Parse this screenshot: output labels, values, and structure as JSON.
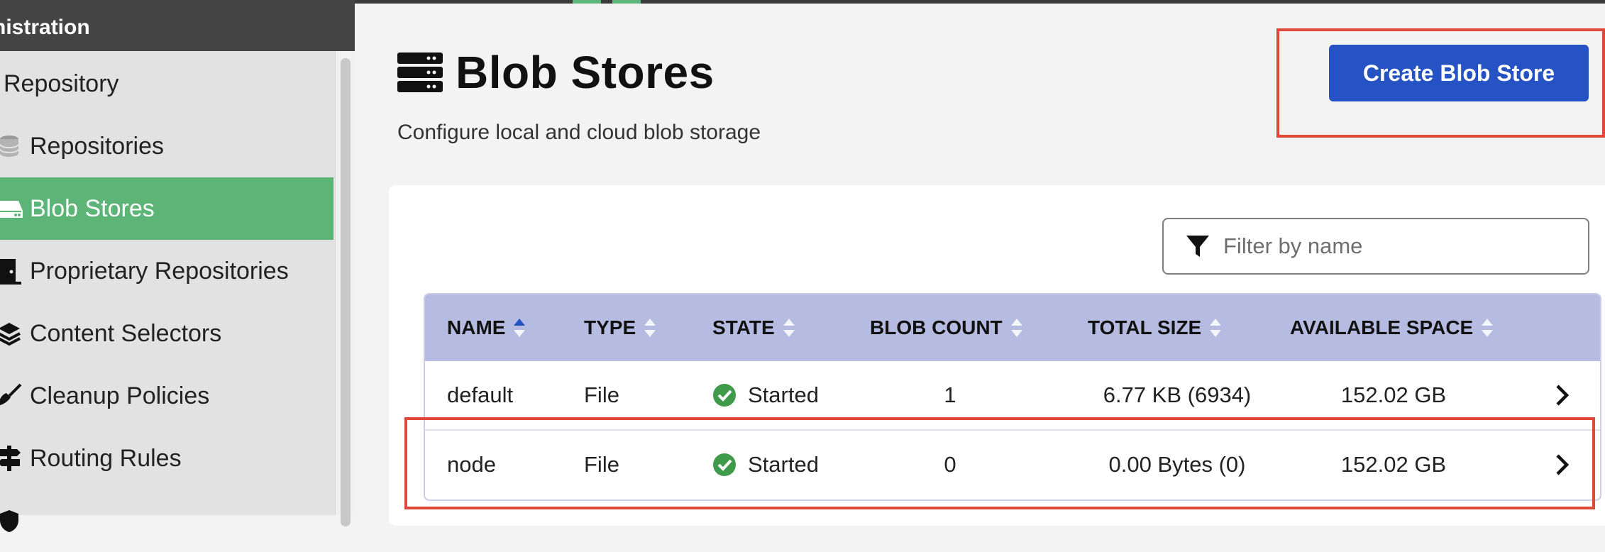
{
  "sidebar": {
    "header": "nistration",
    "group_label": "Repository",
    "items": [
      {
        "label": "Repositories",
        "icon": "database-icon",
        "active": false
      },
      {
        "label": "Blob Stores",
        "icon": "hard-drive-icon",
        "active": true
      },
      {
        "label": "Proprietary Repositories",
        "icon": "door-icon",
        "active": false
      },
      {
        "label": "Content Selectors",
        "icon": "layers-icon",
        "active": false
      },
      {
        "label": "Cleanup Policies",
        "icon": "broom-icon",
        "active": false
      },
      {
        "label": "Routing Rules",
        "icon": "signpost-icon",
        "active": false
      }
    ]
  },
  "main": {
    "title": "Blob Stores",
    "subtitle": "Configure local and cloud blob storage",
    "create_button": "Create Blob Store",
    "filter_placeholder": "Filter by name",
    "table": {
      "columns": [
        "NAME",
        "TYPE",
        "STATE",
        "BLOB COUNT",
        "TOTAL SIZE",
        "AVAILABLE SPACE"
      ],
      "sorted_column": "NAME",
      "rows": [
        {
          "name": "default",
          "type": "File",
          "state": "Started",
          "blob_count": "1",
          "total_size": "6.77 KB (6934)",
          "available_space": "152.02 GB"
        },
        {
          "name": "node",
          "type": "File",
          "state": "Started",
          "blob_count": "0",
          "total_size": "0.00 Bytes (0)",
          "available_space": "152.02 GB"
        }
      ]
    }
  },
  "colors": {
    "sidebar_active": "#5cb577",
    "primary_button": "#2553c3",
    "table_header": "#b6bce1",
    "highlight": "#e0483a",
    "state_ok": "#3f9a4a"
  }
}
